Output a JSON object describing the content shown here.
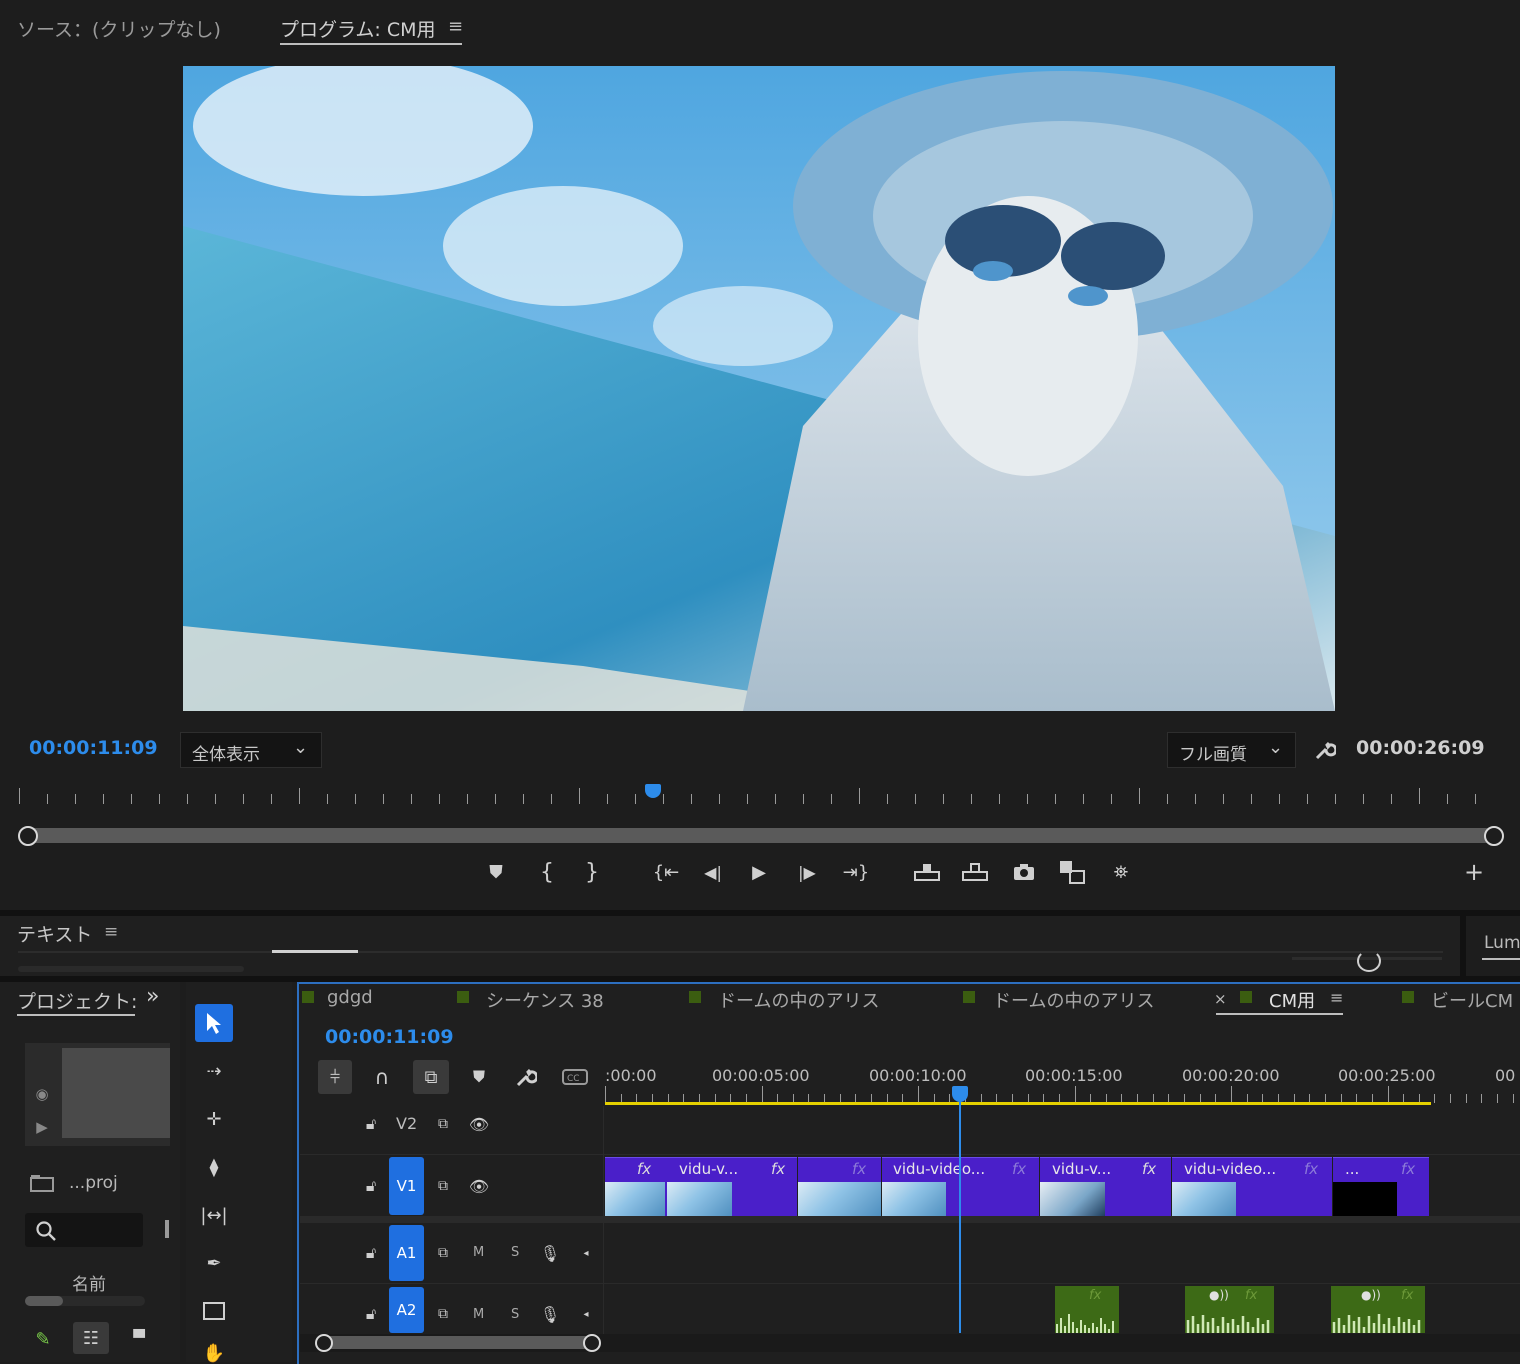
{
  "source_panel": {
    "label": "ソース：(クリップなし)"
  },
  "program_panel": {
    "title": "プログラム: CM用",
    "menu": "≡",
    "current_time": "00:00:11:09",
    "fit": "全体表示",
    "quality": "フル画質",
    "duration": "00:00:26:09",
    "playhead": 0.43
  },
  "text_panel": {
    "title": "テキスト",
    "menu": "≡",
    "right_tab": "Lum"
  },
  "project_panel": {
    "title": "プロジェクト:",
    "more": "»",
    "file": "...proj",
    "column": "名前"
  },
  "timeline": {
    "tabs": [
      "gdgd",
      "シーケンス 38",
      "ドームの中のアリス",
      "ドームの中のアリス",
      "CM用",
      "ビールCM"
    ],
    "close": "×",
    "active_menu": "≡",
    "current_time": "00:00:11:09",
    "ruler": [
      ":00:00",
      "00:00:05:00",
      "00:00:10:00",
      "00:00:15:00",
      "00:00:20:00",
      "00:00:25:00",
      "00"
    ],
    "tracks": {
      "v2": "V2",
      "v1": "V1",
      "a1": "A1",
      "a2": "A2",
      "m": "M",
      "s": "S"
    },
    "clips": [
      "vidu-v...",
      "vidu-video...",
      "vidu-v...",
      "vidu-video...",
      "..."
    ],
    "fx": "fx"
  },
  "colors": {
    "accent": "#2d8ceb",
    "video_clip": "#4a1fc9",
    "audio_clip": "#3d6a16",
    "work_area": "#e5d000"
  }
}
